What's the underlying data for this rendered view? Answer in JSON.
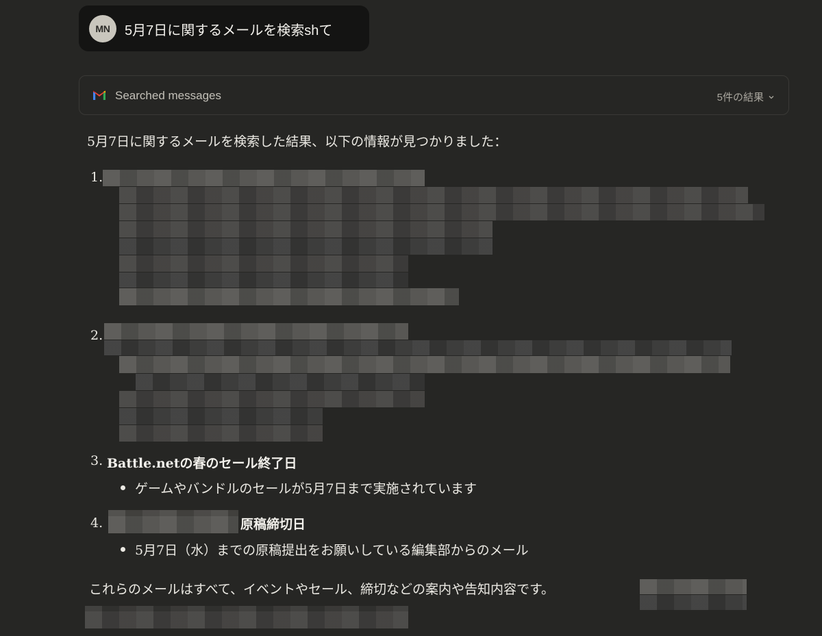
{
  "user_message": {
    "avatar_initials": "MN",
    "text": "5月7日に関するメールを検索shて"
  },
  "tool_call": {
    "icon": "gmail-icon",
    "label": "Searched messages",
    "results_label": "5件の結果",
    "colors": {
      "gmail_red": "#ea4335",
      "gmail_blue": "#4285f4",
      "gmail_green": "#34a853",
      "gmail_yellow": "#fbbc04"
    }
  },
  "response": {
    "intro": "5月7日に関するメールを検索した結果、以下の情報が見つかりました：",
    "items": [
      {
        "number": "1.",
        "heading": "",
        "bullet": ""
      },
      {
        "number": "2.",
        "heading": "",
        "bullet": ""
      },
      {
        "number": "3.",
        "heading": "Battle.netの春のセール終了日",
        "bullet": "ゲームやバンドルのセールが5月7日まで実施されています"
      },
      {
        "number": "4.",
        "heading": "原稿締切日",
        "bullet": "5月7日（水）までの原稿提出をお願いしている編集部からのメール"
      }
    ],
    "outro": "これらのメールはすべて、イベントやセール、締切などの案内や告知内容です。"
  }
}
